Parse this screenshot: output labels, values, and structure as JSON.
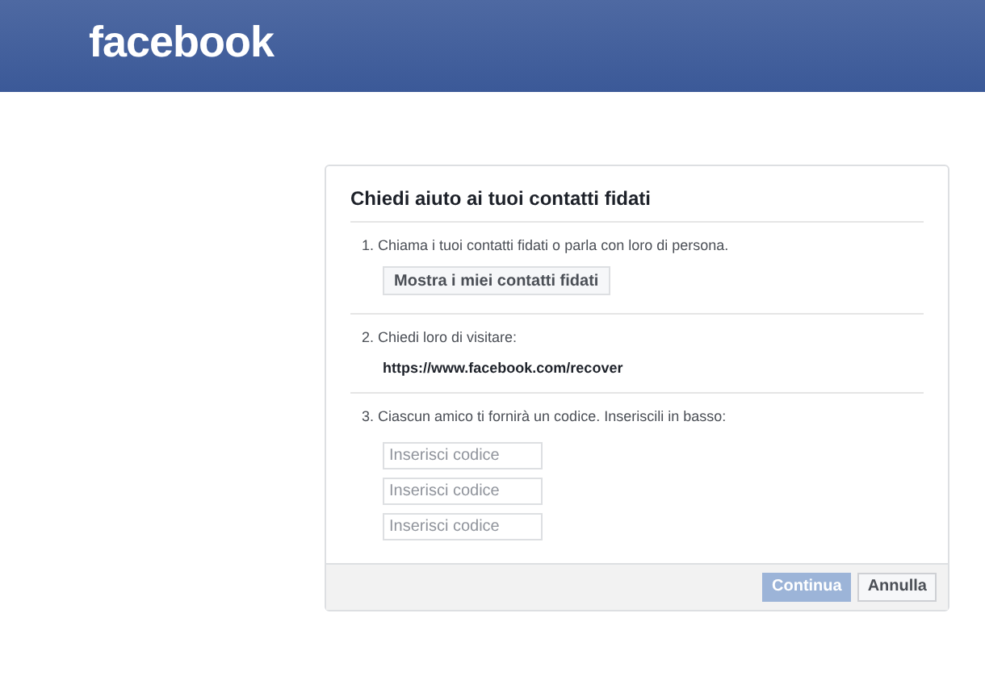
{
  "header": {
    "logo": "facebook"
  },
  "dialog": {
    "title": "Chiedi aiuto ai tuoi contatti fidati",
    "steps": [
      {
        "kind": "button",
        "text": "1. Chiama i tuoi contatti fidati o parla con loro di persona.",
        "button": "Mostra i miei contatti fidati"
      },
      {
        "kind": "url",
        "text": "2. Chiedi loro di visitare:",
        "url": "https://www.facebook.com/recover"
      },
      {
        "kind": "fields",
        "text": "3. Ciascun amico ti fornirà un codice. Inseriscili in basso:",
        "fields": [
          {
            "placeholder": "Inserisci codice"
          },
          {
            "placeholder": "Inserisci codice"
          },
          {
            "placeholder": "Inserisci codice"
          }
        ]
      }
    ],
    "buttons": [
      {
        "label": "Continua",
        "kind": "primary",
        "disabled": true
      },
      {
        "label": "Annulla",
        "kind": "secondary",
        "disabled": false
      }
    ]
  }
}
